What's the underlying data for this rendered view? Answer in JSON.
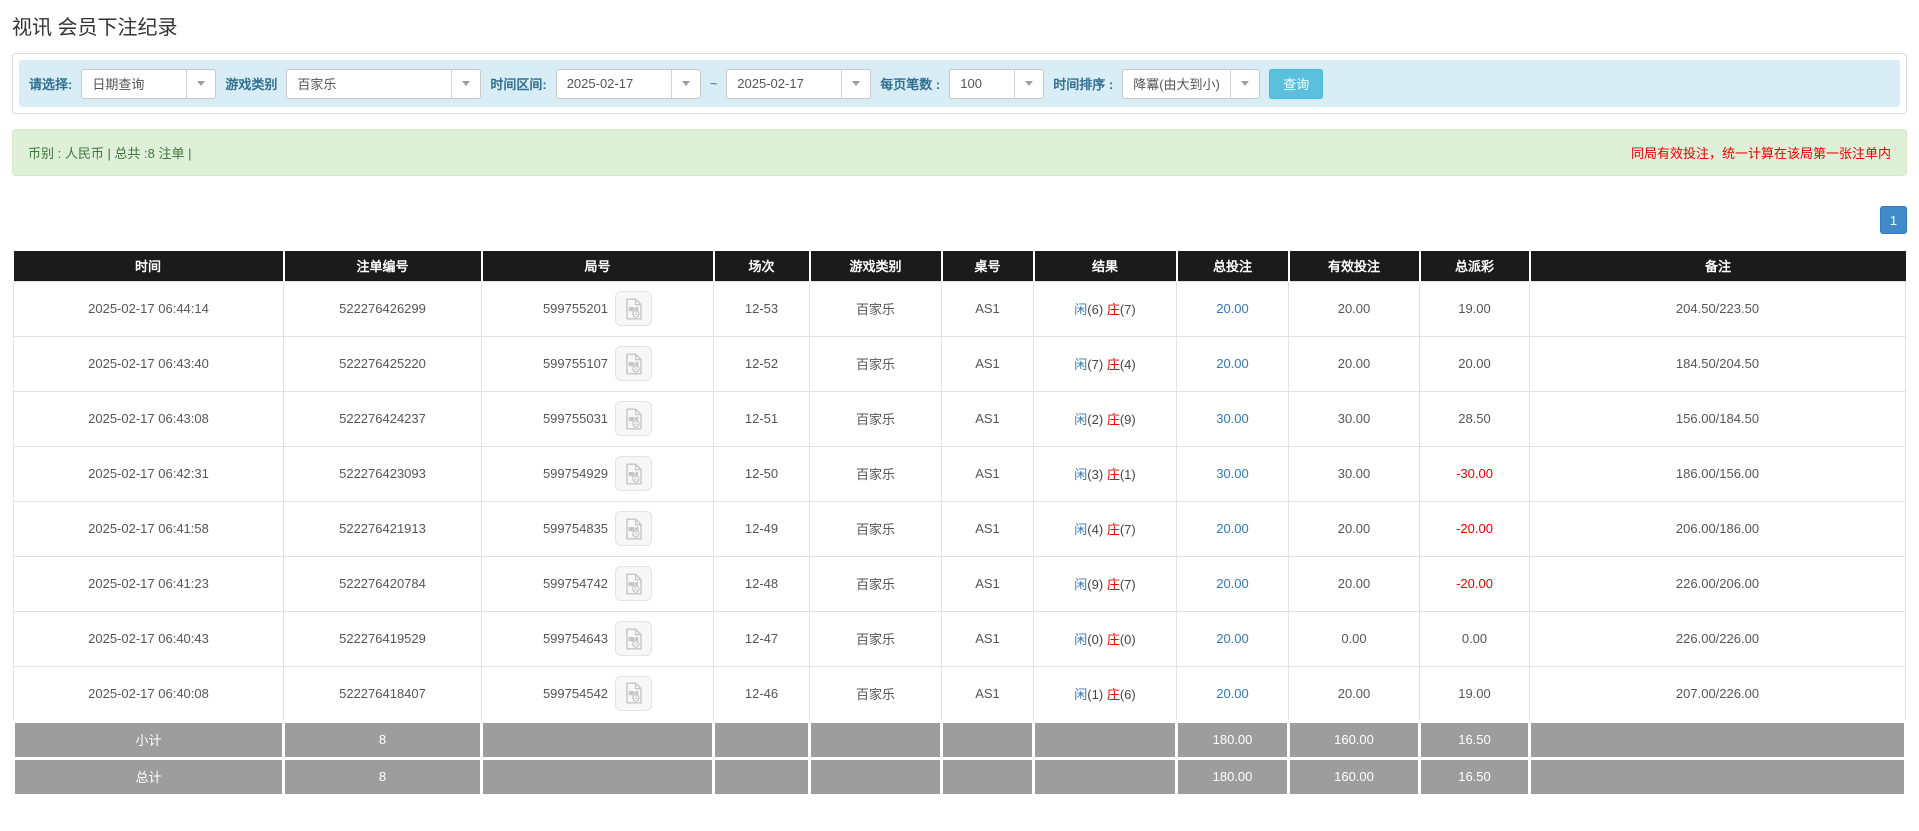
{
  "page": {
    "title": "视讯 会员下注纪录"
  },
  "filters": {
    "select_label": "请选择:",
    "select_value": "日期查询",
    "game_type_label": "游戏类别",
    "game_type_value": "百家乐",
    "time_range_label": "时间区间:",
    "date_from": "2025-02-17",
    "tilde": "~",
    "date_to": "2025-02-17",
    "page_size_label": "每页笔数 :",
    "page_size_value": "100",
    "sort_label": "时间排序 :",
    "sort_value": "降冪(由大到小)",
    "search_button": "查询"
  },
  "summary": {
    "left_text": "币别 : 人民币 | 总共 :8 注单 |",
    "right_notice": "同局有效投注，统一计算在该局第一张注单内"
  },
  "pagination": {
    "current_page": "1"
  },
  "icons": {
    "select_caret": "chevron-down",
    "round_video": "video-record-icon"
  },
  "colors": {
    "filter_bar_bg": "#d9edf7",
    "filter_label": "#31708f",
    "search_btn_bg": "#5bc0de",
    "summary_bg": "#dff0d8",
    "summary_text": "#3c763d",
    "notice_red": "#ee0000",
    "header_bg": "#1b1b1b",
    "footer_bg": "#9d9d9d",
    "link_blue": "#337ab7",
    "player_blue": "#337ab7",
    "banker_red": "#ee0000",
    "page_btn_bg": "#428bca"
  },
  "table": {
    "headers": [
      "时间",
      "注单编号",
      "局号",
      "场次",
      "游戏类别",
      "桌号",
      "结果",
      "总投注",
      "有效投注",
      "总派彩",
      "备注"
    ],
    "rows": [
      {
        "time": "2025-02-17 06:44:14",
        "bet_id": "522276426299",
        "round_id": "599755201",
        "session": "12-53",
        "game": "百家乐",
        "table_no": "AS1",
        "player_label": "闲",
        "player_num": "(6)",
        "banker_label": "庄",
        "banker_num": "(7)",
        "total_bet": "20.00",
        "valid_bet": "20.00",
        "payout": "19.00",
        "remark": "204.50/223.50"
      },
      {
        "time": "2025-02-17 06:43:40",
        "bet_id": "522276425220",
        "round_id": "599755107",
        "session": "12-52",
        "game": "百家乐",
        "table_no": "AS1",
        "player_label": "闲",
        "player_num": "(7)",
        "banker_label": "庄",
        "banker_num": "(4)",
        "total_bet": "20.00",
        "valid_bet": "20.00",
        "payout": "20.00",
        "remark": "184.50/204.50"
      },
      {
        "time": "2025-02-17 06:43:08",
        "bet_id": "522276424237",
        "round_id": "599755031",
        "session": "12-51",
        "game": "百家乐",
        "table_no": "AS1",
        "player_label": "闲",
        "player_num": "(2)",
        "banker_label": "庄",
        "banker_num": "(9)",
        "total_bet": "30.00",
        "valid_bet": "30.00",
        "payout": "28.50",
        "remark": "156.00/184.50"
      },
      {
        "time": "2025-02-17 06:42:31",
        "bet_id": "522276423093",
        "round_id": "599754929",
        "session": "12-50",
        "game": "百家乐",
        "table_no": "AS1",
        "player_label": "闲",
        "player_num": "(3)",
        "banker_label": "庄",
        "banker_num": "(1)",
        "total_bet": "30.00",
        "valid_bet": "30.00",
        "payout": "-30.00",
        "remark": "186.00/156.00"
      },
      {
        "time": "2025-02-17 06:41:58",
        "bet_id": "522276421913",
        "round_id": "599754835",
        "session": "12-49",
        "game": "百家乐",
        "table_no": "AS1",
        "player_label": "闲",
        "player_num": "(4)",
        "banker_label": "庄",
        "banker_num": "(7)",
        "total_bet": "20.00",
        "valid_bet": "20.00",
        "payout": "-20.00",
        "remark": "206.00/186.00"
      },
      {
        "time": "2025-02-17 06:41:23",
        "bet_id": "522276420784",
        "round_id": "599754742",
        "session": "12-48",
        "game": "百家乐",
        "table_no": "AS1",
        "player_label": "闲",
        "player_num": "(9)",
        "banker_label": "庄",
        "banker_num": "(7)",
        "total_bet": "20.00",
        "valid_bet": "20.00",
        "payout": "-20.00",
        "remark": "226.00/206.00"
      },
      {
        "time": "2025-02-17 06:40:43",
        "bet_id": "522276419529",
        "round_id": "599754643",
        "session": "12-47",
        "game": "百家乐",
        "table_no": "AS1",
        "player_label": "闲",
        "player_num": "(0)",
        "banker_label": "庄",
        "banker_num": "(0)",
        "total_bet": "20.00",
        "valid_bet": "0.00",
        "payout": "0.00",
        "remark": "226.00/226.00"
      },
      {
        "time": "2025-02-17 06:40:08",
        "bet_id": "522276418407",
        "round_id": "599754542",
        "session": "12-46",
        "game": "百家乐",
        "table_no": "AS1",
        "player_label": "闲",
        "player_num": "(1)",
        "banker_label": "庄",
        "banker_num": "(6)",
        "total_bet": "20.00",
        "valid_bet": "20.00",
        "payout": "19.00",
        "remark": "207.00/226.00"
      }
    ],
    "subtotal": {
      "label": "小计",
      "count": "8",
      "total_bet": "180.00",
      "valid_bet": "160.00",
      "payout": "16.50"
    },
    "total": {
      "label": "总计",
      "count": "8",
      "total_bet": "180.00",
      "valid_bet": "160.00",
      "payout": "16.50"
    }
  }
}
